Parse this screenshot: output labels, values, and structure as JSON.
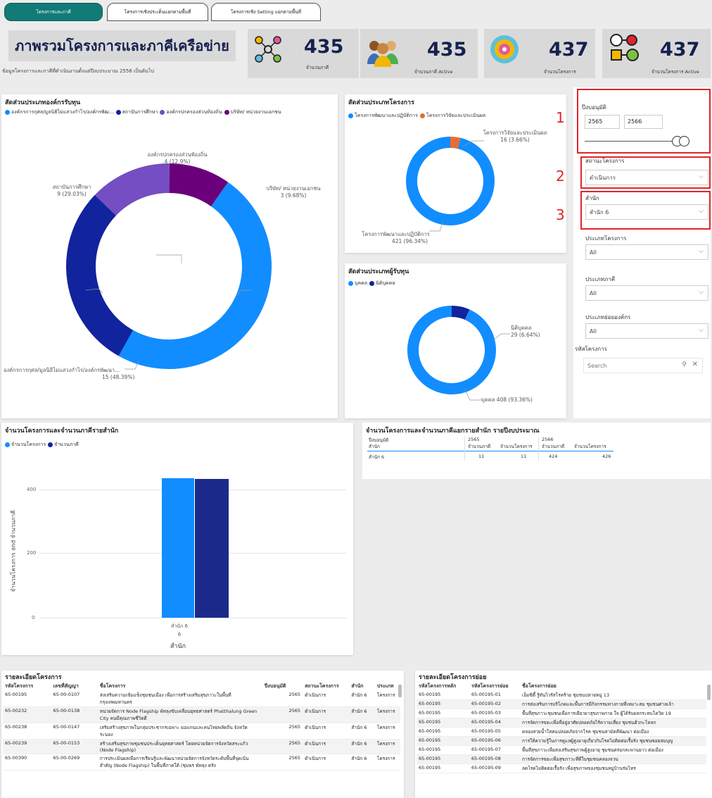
{
  "tabs": [
    {
      "label": "โครงการและภาคี"
    },
    {
      "label": "โครงการเชิงประเด็นแยกตามพื้นที่"
    },
    {
      "label": "โครงการเชิง Setting แยกตามพื้นที่"
    }
  ],
  "header": {
    "title": "ภาพรวมโครงการและภาคีเครือข่าย",
    "subtitle": "ข้อมูลโครงการและภาคีที่ดำเนินงานตั้งแต่ปีงบประมาณ 2556 เป็นต้นไป"
  },
  "kpis": [
    {
      "value": "435",
      "label": "จำนวนภาคี",
      "icon": "network-people-icon"
    },
    {
      "value": "435",
      "label": "จำนวนภาคี Active",
      "icon": "people-group-icon"
    },
    {
      "value": "437",
      "label": "จำนวนโครงการ",
      "icon": "target-icon"
    },
    {
      "value": "437",
      "label": "จำนวนโครงการ Active",
      "icon": "project-money-icon"
    }
  ],
  "donut_org": {
    "title": "สัดส่วนประเภทองค์กรรับทุน",
    "legend": [
      {
        "label": "องค์กรการกุศล/มูลนิธิไม่แสวงกำไร/องค์กรพัฒ...",
        "color": "#118dff"
      },
      {
        "label": "สถาบันการศึกษา",
        "color": "#12239e"
      },
      {
        "label": "องค์กรปกครองส่วนท้องถิ่น",
        "color": "#744ec2"
      },
      {
        "label": "บริษัท/ หน่วยงานเอกชน",
        "color": "#6b007b"
      }
    ],
    "labels": [
      {
        "name": "องค์กรปกครองส่วนท้องถิ่น",
        "value": "4 (12.9%)"
      },
      {
        "name": "สถาบันการศึกษา",
        "value": "9 (29.03%)"
      },
      {
        "name": "บริษัท/ หน่วยงานเอกชน",
        "value": "3 (9.68%)"
      },
      {
        "name": "องค์กรการกุศล/มูลนิธิไม่แสวงกำไร/องค์กรพัฒนา...",
        "value": "15 (48.39%)"
      }
    ]
  },
  "donut_proj": {
    "title": "สัดส่วนประเภทโครงการ",
    "legend": [
      {
        "label": "โครงการพัฒนาและปฏิบัติการ",
        "color": "#118dff"
      },
      {
        "label": "โครงการวิจัยและประเมินผล",
        "color": "#e66c37"
      }
    ],
    "labels": [
      {
        "name": "โครงการวิจัยและประเมินผล",
        "value": "16 (3.66%)"
      },
      {
        "name": "โครงการพัฒนาและปฏิบัติการ",
        "value": "421 (96.34%)"
      }
    ]
  },
  "donut_recv": {
    "title": "สัดส่วนประเภทผู้รับทุน",
    "legend": [
      {
        "label": "บุคคล",
        "color": "#118dff"
      },
      {
        "label": "นิติบุคคล",
        "color": "#12239e"
      }
    ],
    "labels": [
      {
        "name": "นิติบุคคล",
        "value": "29 (6.64%)"
      },
      {
        "name": "บุคคล",
        "value": "408 (93.36%)"
      }
    ]
  },
  "filters": {
    "year_label": "ปีงบอนุมัติ",
    "year_from": "2565",
    "year_to": "2566",
    "status_label": "สถานะโครงการ",
    "status_value": "ดำเนินการ",
    "office_label": "สำนัก",
    "office_value": "สำนัก 6",
    "projtype_label": "ประเภทโครงการ",
    "projtype_value": "All",
    "partytype_label": "ประเภทภาคี",
    "partytype_value": "All",
    "suborg_label": "ประเภทย่อยองค์กร",
    "suborg_value": "All",
    "code_label": "รหัสโครงการ",
    "search_placeholder": "Search",
    "markers": [
      "1",
      "2",
      "3"
    ]
  },
  "bar_chart": {
    "title": "จำนวนโครงการและจำนวนภาคีรายสำนัก",
    "ylabel": "จำนวนโครงการ and จำนวนภาคี",
    "xlabel": "สำนัก",
    "category_line1": "สำนัก 6",
    "category_line2": "6"
  },
  "matrix": {
    "title": "จำนวนโครงการและจำนวนภาคีแยกรายสำนัก รายปีงบประมาณ",
    "h_year": "ปีงบอนุมัติ",
    "h_office": "สำนัก",
    "y1": "2565",
    "y2": "2566",
    "c1": "จำนวนภาคี",
    "c2": "จำนวนโครงการ",
    "c3": "จำนวนภาคี",
    "c4": "จำนวนโครงการ",
    "row_office": "สำนัก 6",
    "v1": "11",
    "v2": "11",
    "v3": "424",
    "v4": "426"
  },
  "detail": {
    "title": "รายละเอียดโครงการ",
    "headers": [
      "รหัสโครงการ",
      "เลขที่สัญญา",
      "ชื่อโครงการ",
      "ปีงบอนุมัติ",
      "สถานะโครงการ",
      "สำนัก",
      "ประเภท"
    ],
    "rows": [
      [
        "65-00195",
        "65-00-0107",
        "ส่งเสริมความเข้มแข็งชุมชนเมือง เพื่อการสร้างเสริมสุขภาวะในพื้นที่กรุงเทพมหานคร",
        "2565",
        "ดำเนินการ",
        "สำนัก 6",
        "โครงการ"
      ],
      [
        "65-00232",
        "65-00-0138",
        "หน่วยจัดการ Node Flagship พัทลุงขับเคลื่อนยุทธศาสตร์ Phatthalung Green City คนมีคุณภาพชีวิตดี",
        "2565",
        "ดำเนินการ",
        "สำนัก 6",
        "โครงการ"
      ],
      [
        "65-00238",
        "65-00-0147",
        "เสริมสร้างสุขภาพในกลุ่มประชากรเฉพาะ มอแกนและคนไทยพลัดถิ่น จังหวัดระนอง",
        "2565",
        "ดำเนินการ",
        "สำนัก 6",
        "โครงการ"
      ],
      [
        "65-00239",
        "65-00-0153",
        "สร้างเสริมสุขภาพชุมชนประเด็นยุทธศาสตร์ โดยหน่วยจัดการจังหวัดสระแก้ว (Node Flagship)",
        "2565",
        "ดำเนินการ",
        "สำนัก 6",
        "โครงการ"
      ],
      [
        "65-00390",
        "65-00-0269",
        "การประเมินผลเพื่อการเรียนรู้และพัฒนาหน่วยจัดการจังหวัดระดับพื้นที่จุดเน้นสำคัญ (Node Flagship) ในพื้นที่ภาคใต้ (ชุมพร พัทลุง ตรัง",
        "2565",
        "ดำเนินการ",
        "สำนัก 6",
        "โครงการ"
      ]
    ]
  },
  "subdetail": {
    "title": "รายละเอียดโครงการย่อย",
    "headers": [
      "รหัสโครงการหลัก",
      "รหัสโครงการย่อย",
      "ชื่อโครงการย่อย"
    ],
    "rows": [
      [
        "65-00195",
        "65-00195-01",
        "เอ็มซิตี้ รู้ทันไวรัสโรคร้าย ชุมชนปลายหมู่ 13"
      ],
      [
        "65-00195",
        "65-00195-02",
        "การส่งเสริมการบริโภคและพื้นการมีกิจกรรมทางกายที่เหมาะสม ชุมชนศาลเจ้า"
      ],
      [
        "65-00195",
        "65-00195-03",
        "พื้นที่สุขภาวะชุมชนเพื่อการเยียวยาสุขภาพกาย ใจ ผู้ได้รับผลกระทบโควิด 19"
      ],
      [
        "65-00195",
        "65-00195-04",
        "การจัดการขยะเพื่อที่อยู่อาศัยปลอดภัยไร้ความเสี่ยง ชุมชนฮ้วกะโหลก"
      ],
      [
        "65-00195",
        "65-00195-05",
        "คลองสวยน้ำใสคนปลอดภัยจากโรค ชุมชนสามัคคีพัฒนา ต่อเมือง"
      ],
      [
        "65-00195",
        "65-00195-06",
        "การให้ความรู้ในการดูแลผู้สูงอายุเกี่ยวกับโรคไม่ติดต่อเรื้อรัง ชุมชนซอยสมบุญ"
      ],
      [
        "65-00195",
        "65-00195-07",
        "พื้นที่สุขภาวะเพื่อส่งเสริมสุขภาพผู้สูงอายุ ชุมชนตรอกสะพานยาว ต่อเมือง"
      ],
      [
        "65-00195",
        "65-00195-08",
        "การจัดการขยะเพื่อสุขภาวะที่ดีในชุมชนคลองจวน"
      ],
      [
        "65-00195",
        "65-00195-09",
        "ลดโรคไม่ติดต่อเรื้อรัง เพื่อสุขภาพของชุมชนหมู่บ้านร่มไทร"
      ]
    ]
  },
  "colors": {
    "accent": "#127a77",
    "navy": "#15214f",
    "blue": "#118dff",
    "dark_blue": "#12239e",
    "purple": "#744ec2",
    "violet": "#6b007b",
    "orange": "#e66c37",
    "red": "#e0242b"
  }
}
